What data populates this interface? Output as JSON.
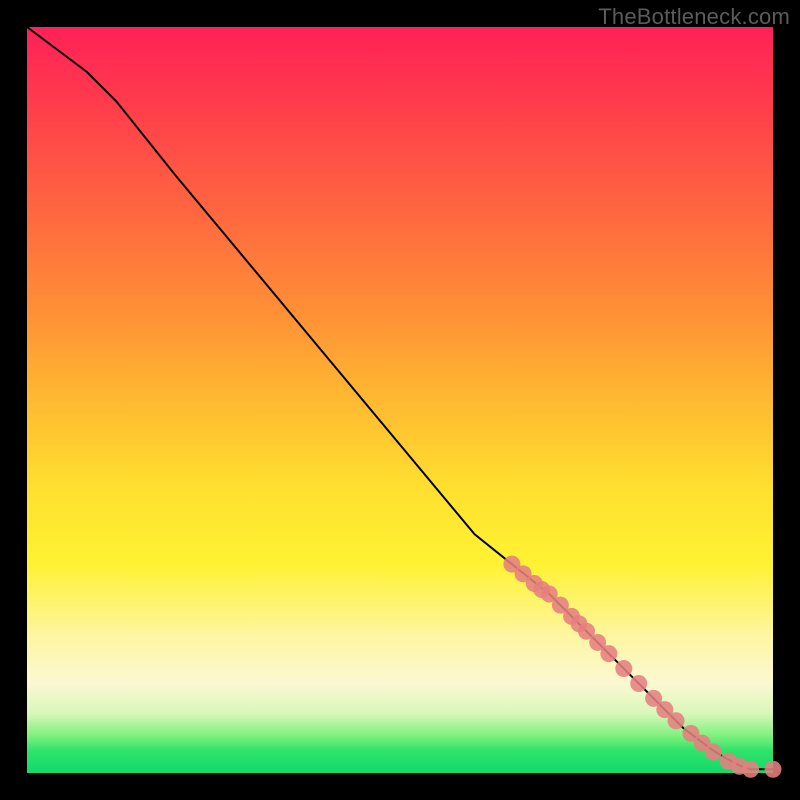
{
  "watermark": "TheBottleneck.com",
  "colors": {
    "background": "#000000",
    "curve": "#000000",
    "marker": "#e58080",
    "gradient_top": "#ff2158",
    "gradient_bottom": "#12d96c"
  },
  "chart_data": {
    "type": "line",
    "title": "",
    "xlabel": "",
    "ylabel": "",
    "xlim": [
      0,
      100
    ],
    "ylim": [
      0,
      100
    ],
    "grid": false,
    "legend": false,
    "curve": {
      "name": "bottleneck-curve",
      "x": [
        0,
        4,
        8,
        12,
        20,
        30,
        40,
        50,
        60,
        65,
        70,
        75,
        80,
        85,
        88,
        90,
        92,
        94,
        95.5,
        97,
        100
      ],
      "y": [
        100,
        97,
        94,
        90,
        80,
        68,
        56,
        44,
        32,
        28,
        24,
        19,
        14,
        9,
        6,
        4.5,
        3,
        1.8,
        1.0,
        0.5,
        0.5
      ]
    },
    "markers": {
      "name": "dense-segment-points",
      "style": "circle",
      "color": "#e58080",
      "radius": 8.5,
      "points": [
        {
          "x": 65.0,
          "y": 28.0
        },
        {
          "x": 66.5,
          "y": 26.7
        },
        {
          "x": 68.0,
          "y": 25.4
        },
        {
          "x": 69.0,
          "y": 24.6
        },
        {
          "x": 70.0,
          "y": 24.0
        },
        {
          "x": 71.5,
          "y": 22.5
        },
        {
          "x": 73.0,
          "y": 21.0
        },
        {
          "x": 74.0,
          "y": 20.0
        },
        {
          "x": 75.0,
          "y": 19.0
        },
        {
          "x": 76.5,
          "y": 17.5
        },
        {
          "x": 78.0,
          "y": 16.0
        },
        {
          "x": 80.0,
          "y": 14.0
        },
        {
          "x": 82.0,
          "y": 12.0
        },
        {
          "x": 84.0,
          "y": 10.0
        },
        {
          "x": 85.5,
          "y": 8.5
        },
        {
          "x": 87.0,
          "y": 7.0
        },
        {
          "x": 89.0,
          "y": 5.3
        },
        {
          "x": 90.5,
          "y": 4.0
        },
        {
          "x": 92.0,
          "y": 2.8
        },
        {
          "x": 94.0,
          "y": 1.6
        },
        {
          "x": 95.5,
          "y": 0.9
        },
        {
          "x": 97.0,
          "y": 0.5
        },
        {
          "x": 100.0,
          "y": 0.5
        }
      ]
    }
  }
}
